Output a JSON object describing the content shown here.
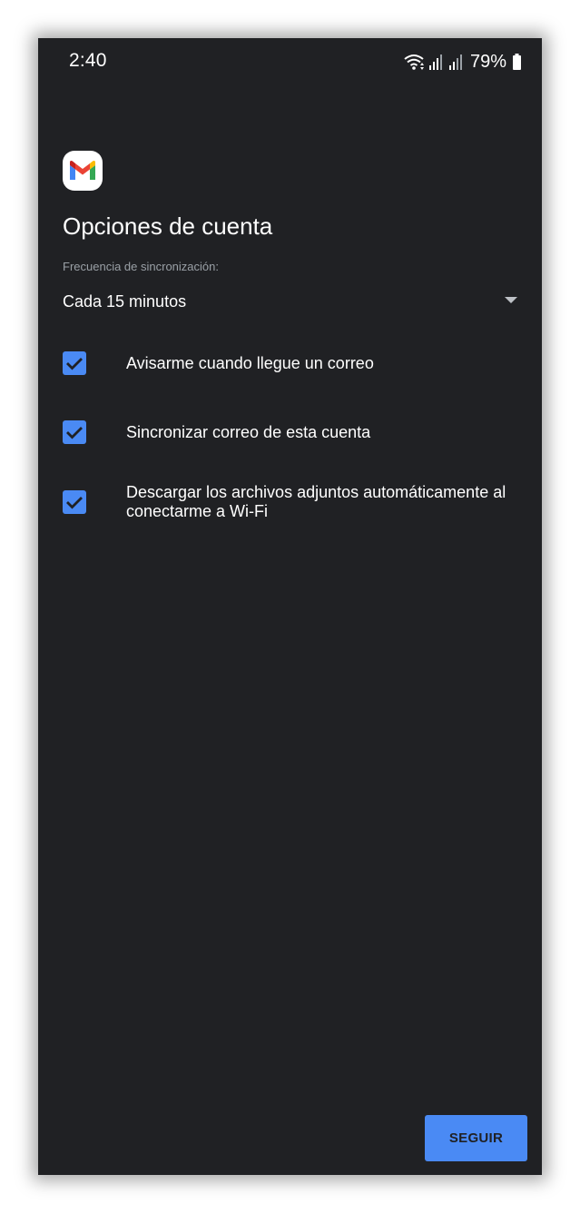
{
  "status_bar": {
    "time": "2:40",
    "battery_percent": "79%",
    "icons": [
      "wifi-icon",
      "signal-icon",
      "signal-icon",
      "battery-icon"
    ]
  },
  "app": {
    "logo_icon": "gmail-logo-icon"
  },
  "page": {
    "title": "Opciones de cuenta",
    "frequency_label": "Frecuencia de sincronización:",
    "frequency_value": "Cada 15 minutos"
  },
  "options": [
    {
      "label": "Avisarme cuando llegue un correo",
      "checked": true
    },
    {
      "label": "Sincronizar correo de esta cuenta",
      "checked": true
    },
    {
      "label": "Descargar los archivos adjuntos automáticamente al conectarme a Wi-Fi",
      "checked": true
    }
  ],
  "actions": {
    "continue_label": "SEGUIR"
  },
  "colors": {
    "background": "#202124",
    "accent": "#4a8af4",
    "text": "#ffffff",
    "secondary_text": "#9aa0a6"
  }
}
